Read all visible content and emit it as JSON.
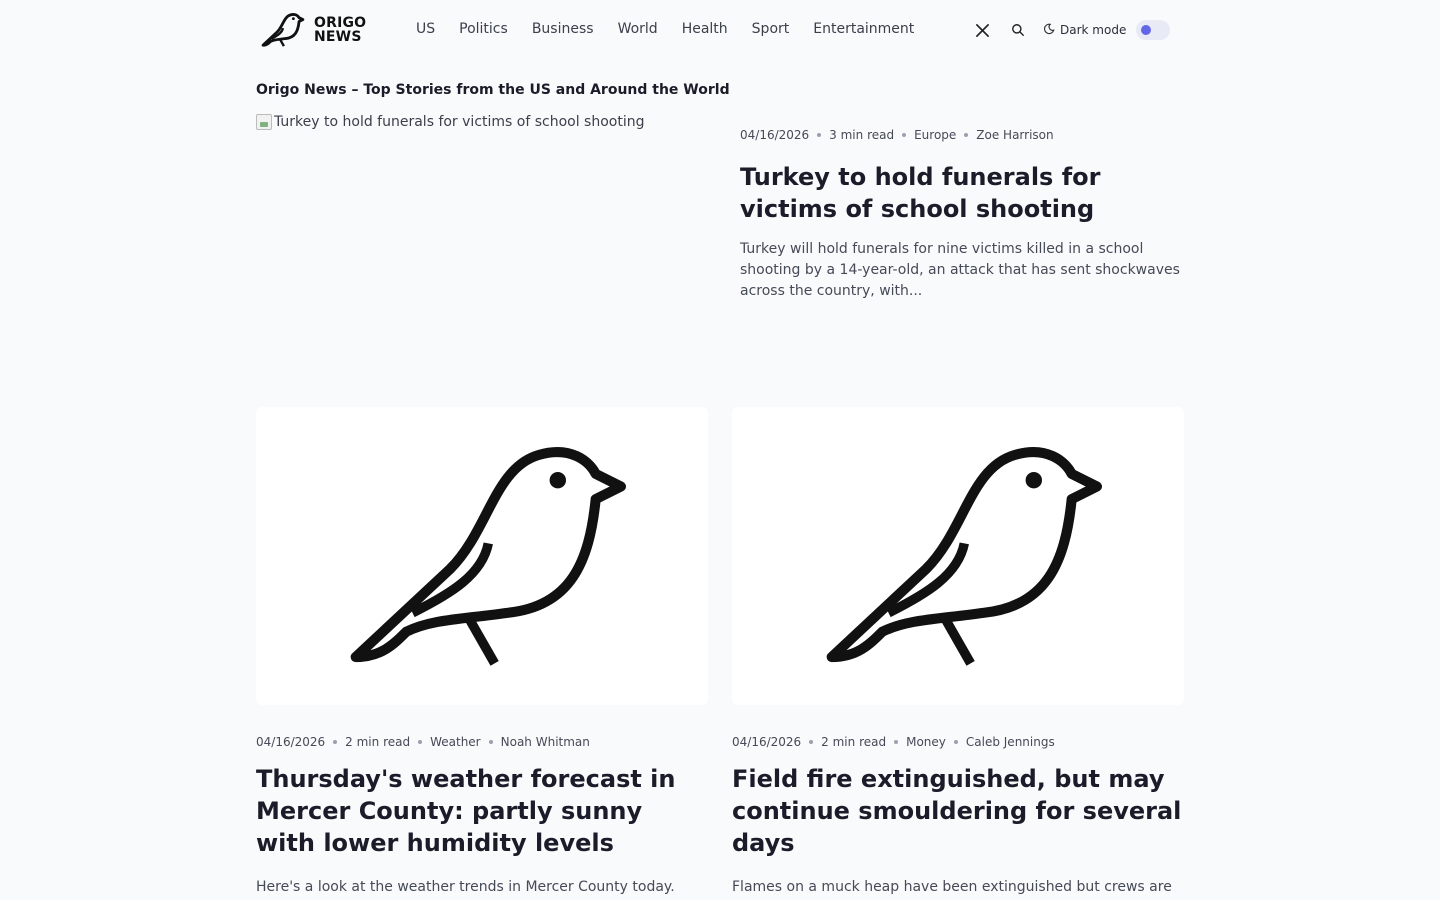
{
  "brand": {
    "line1": "ORIGO",
    "line2": "NEWS"
  },
  "nav": [
    {
      "label": "US"
    },
    {
      "label": "Politics"
    },
    {
      "label": "Business"
    },
    {
      "label": "World"
    },
    {
      "label": "Health"
    },
    {
      "label": "Sport"
    },
    {
      "label": "Entertainment"
    }
  ],
  "header_right": {
    "dark_mode_label": "Dark mode",
    "dark_mode_on": false
  },
  "page_title": "Origo News – Top Stories from the US and Around the World",
  "featured": {
    "image_alt": "Turkey to hold funerals for victims of school shooting",
    "date": "04/16/2026",
    "read_time": "3 min read",
    "category": "Europe",
    "author": "Zoe Harrison",
    "title": "Turkey to hold funerals for victims of school shooting",
    "excerpt": "Turkey will hold funerals for nine victims killed in a school shooting by a 14-year-old, an attack that has sent shockwaves across the country, with..."
  },
  "cards": [
    {
      "date": "04/16/2026",
      "read_time": "2 min read",
      "category": "Weather",
      "author": "Noah Whitman",
      "title": "Thursday's weather forecast in Mercer County: partly sunny with lower humidity levels",
      "excerpt": "Here's a look at the weather trends in Mercer County today."
    },
    {
      "date": "04/16/2026",
      "read_time": "2 min read",
      "category": "Money",
      "author": "Caleb Jennings",
      "title": "Field fire extinguished, but may continue smouldering for several days",
      "excerpt": "Flames on a muck heap have been extinguished but crews are still monitoring it, a fire service says."
    }
  ],
  "colors": {
    "background": "#f9fafc",
    "accent": "#6466e8",
    "text": "#1a1d29"
  }
}
